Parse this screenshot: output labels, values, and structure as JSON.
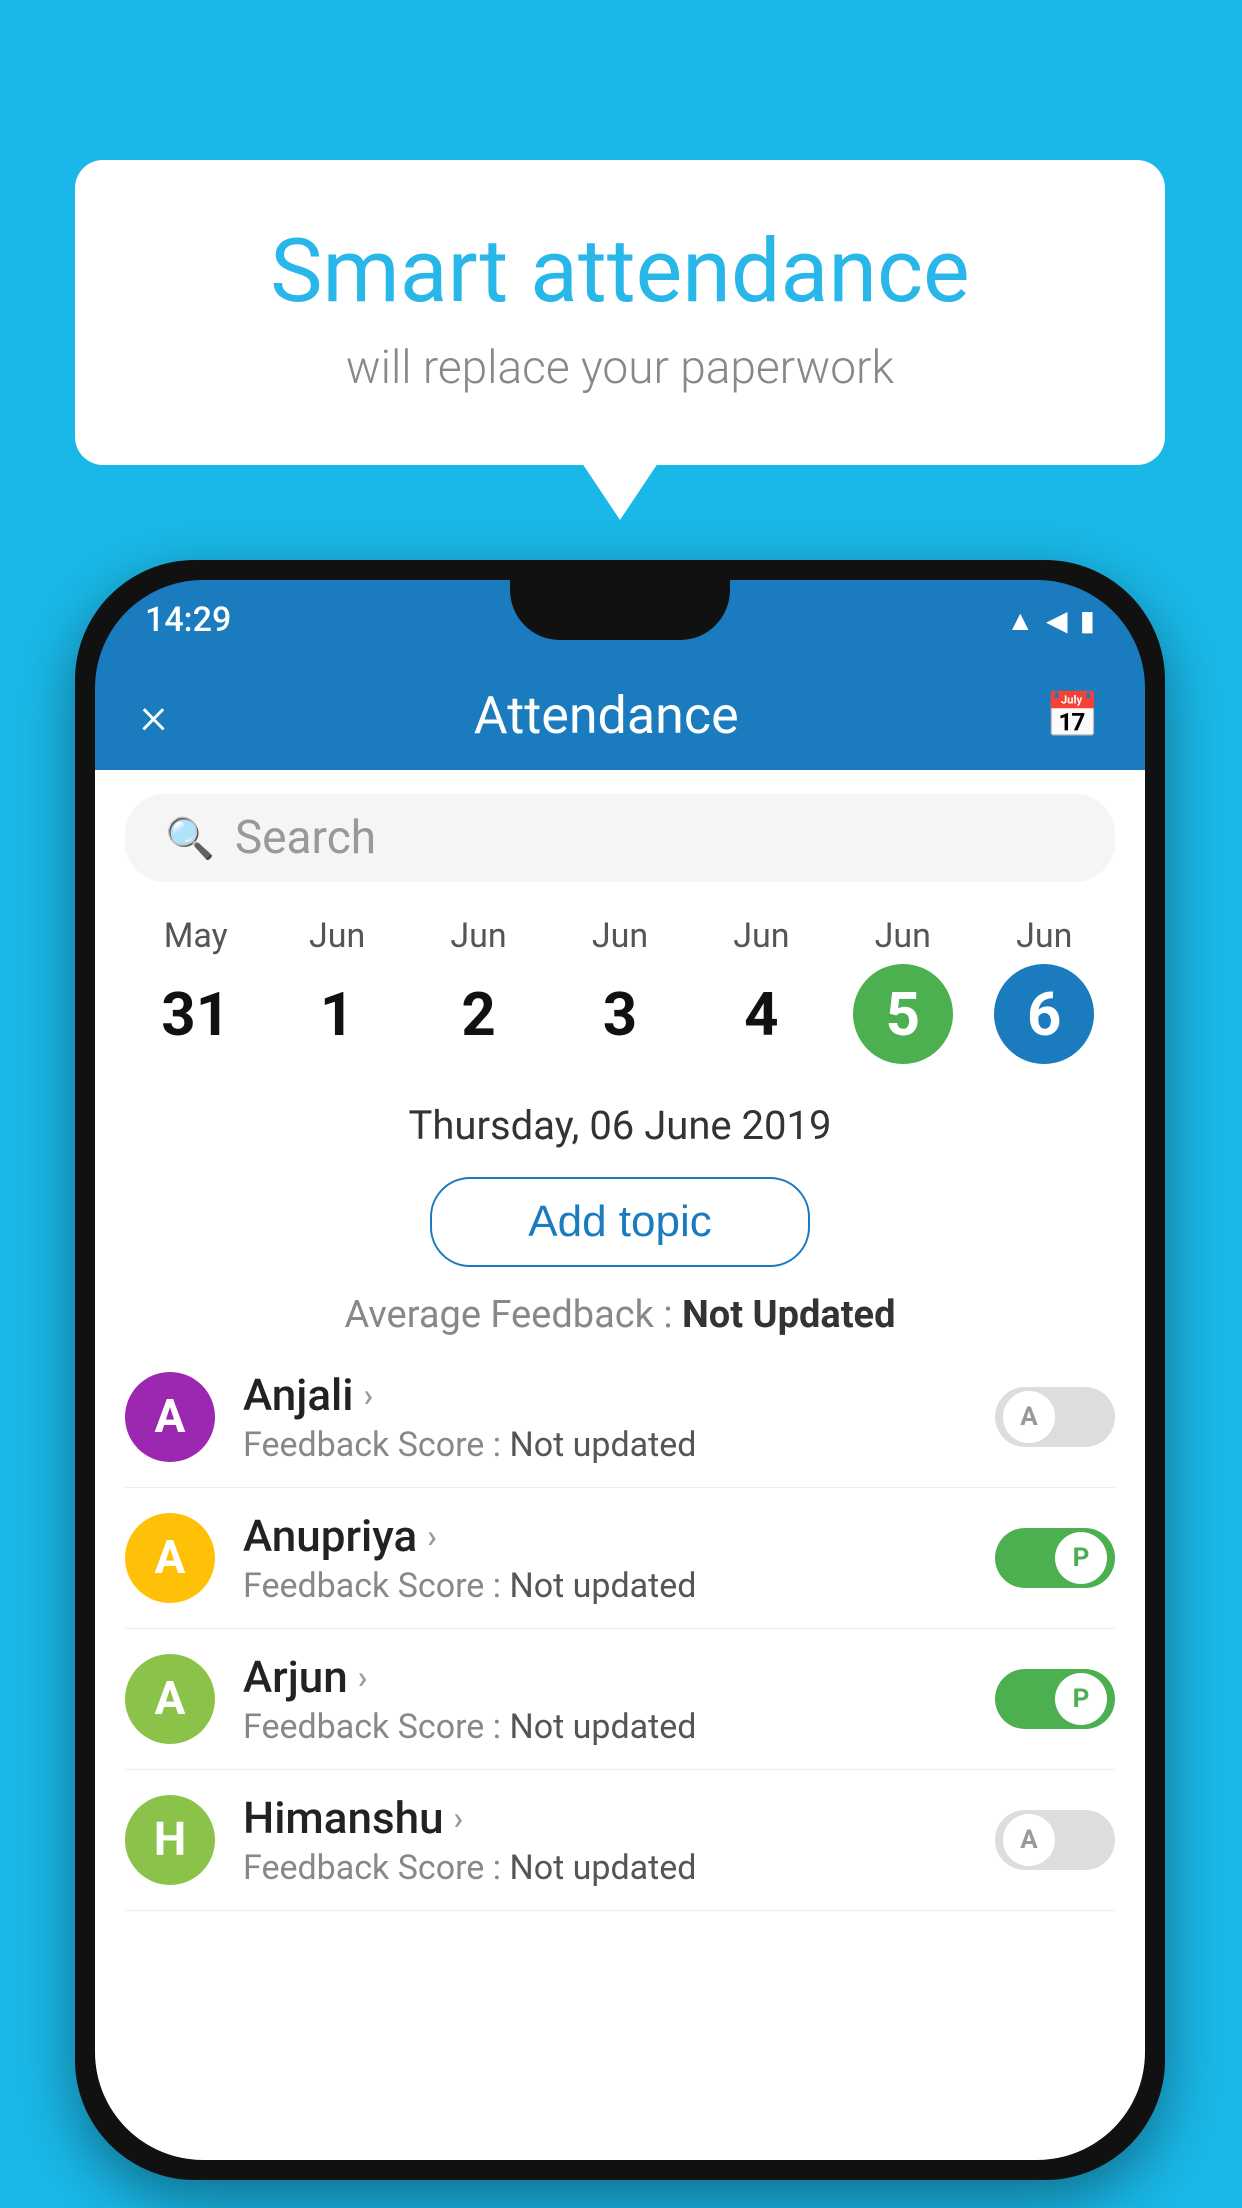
{
  "background_color": "#1ab8e8",
  "speech_bubble": {
    "title": "Smart attendance",
    "subtitle": "will replace your paperwork"
  },
  "status_bar": {
    "time": "14:29",
    "icons": [
      "wifi",
      "signal",
      "battery"
    ]
  },
  "header": {
    "close_label": "×",
    "title": "Attendance",
    "calendar_icon": "📅"
  },
  "search": {
    "placeholder": "Search"
  },
  "dates": [
    {
      "month": "May",
      "day": "31",
      "selected": false
    },
    {
      "month": "Jun",
      "day": "1",
      "selected": false
    },
    {
      "month": "Jun",
      "day": "2",
      "selected": false
    },
    {
      "month": "Jun",
      "day": "3",
      "selected": false
    },
    {
      "month": "Jun",
      "day": "4",
      "selected": false
    },
    {
      "month": "Jun",
      "day": "5",
      "selected": "green"
    },
    {
      "month": "Jun",
      "day": "6",
      "selected": "blue"
    }
  ],
  "selected_date": "Thursday, 06 June 2019",
  "add_topic_label": "Add topic",
  "avg_feedback_label": "Average Feedback :",
  "avg_feedback_value": "Not Updated",
  "students": [
    {
      "name": "Anjali",
      "avatar_letter": "A",
      "avatar_color": "#9c27b0",
      "feedback_label": "Feedback Score :",
      "feedback_value": "Not updated",
      "toggle": "off",
      "toggle_letter": "A"
    },
    {
      "name": "Anupriya",
      "avatar_letter": "A",
      "avatar_color": "#ffc107",
      "feedback_label": "Feedback Score :",
      "feedback_value": "Not updated",
      "toggle": "on",
      "toggle_letter": "P"
    },
    {
      "name": "Arjun",
      "avatar_letter": "A",
      "avatar_color": "#8bc34a",
      "feedback_label": "Feedback Score :",
      "feedback_value": "Not updated",
      "toggle": "on",
      "toggle_letter": "P"
    },
    {
      "name": "Himanshu",
      "avatar_letter": "H",
      "avatar_color": "#8bc34a",
      "feedback_label": "Feedback Score :",
      "feedback_value": "Not updated",
      "toggle": "off",
      "toggle_letter": "A"
    }
  ]
}
